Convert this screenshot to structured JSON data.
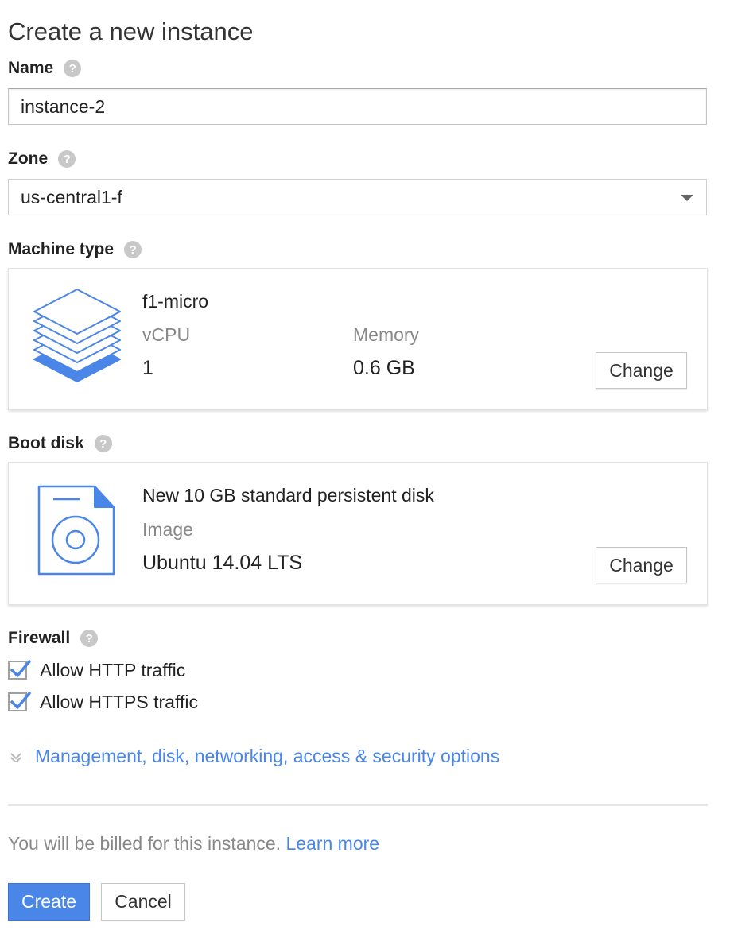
{
  "page": {
    "title": "Create a new instance"
  },
  "name_section": {
    "label": "Name",
    "help_icon": "help-icon",
    "value": "instance-2"
  },
  "zone_section": {
    "label": "Zone",
    "help_icon": "help-icon",
    "selected": "us-central1-f"
  },
  "machine_type": {
    "label": "Machine type",
    "icon": "stacked-layers-icon",
    "name": "f1-micro",
    "vcpu_label": "vCPU",
    "vcpu_value": "1",
    "memory_label": "Memory",
    "memory_value": "0.6 GB",
    "change_label": "Change"
  },
  "boot_disk": {
    "label": "Boot disk",
    "icon": "disk-file-icon",
    "title": "New 10 GB standard persistent disk",
    "image_label": "Image",
    "image_value": "Ubuntu 14.04 LTS",
    "change_label": "Change"
  },
  "firewall": {
    "label": "Firewall",
    "options": [
      {
        "label": "Allow HTTP traffic",
        "checked": true
      },
      {
        "label": "Allow HTTPS traffic",
        "checked": true
      }
    ]
  },
  "advanced": {
    "label": "Management, disk, networking, access & security options",
    "icon": "chevron-down-icon"
  },
  "billing": {
    "text": "You will be billed for this instance.",
    "link": "Learn more"
  },
  "actions": {
    "create_label": "Create",
    "cancel_label": "Cancel"
  },
  "colors": {
    "accent": "#4a86e8",
    "muted_text": "#888888",
    "border": "#c4c4c4"
  }
}
